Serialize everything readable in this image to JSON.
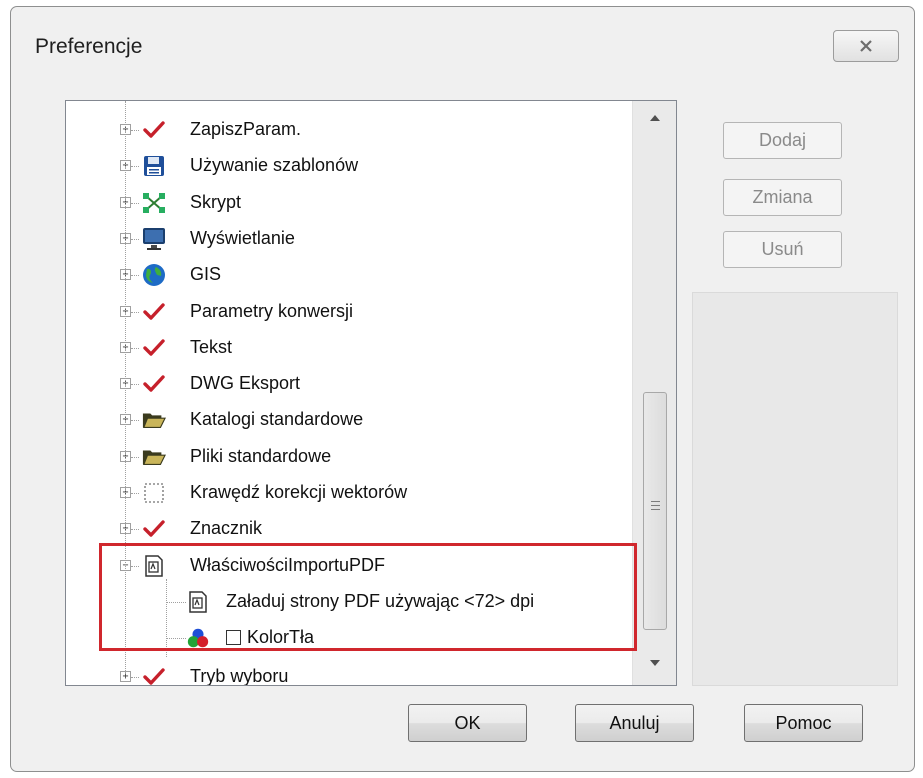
{
  "window": {
    "title": "Preferencje"
  },
  "tree": {
    "items": [
      {
        "label": "ZapiszParam.",
        "icon": "check-mark-icon"
      },
      {
        "label": "Używanie szablonów",
        "icon": "floppy-disk-icon"
      },
      {
        "label": "Skrypt",
        "icon": "script-network-icon"
      },
      {
        "label": "Wyświetlanie",
        "icon": "monitor-icon"
      },
      {
        "label": "GIS",
        "icon": "globe-icon"
      },
      {
        "label": "Parametry konwersji",
        "icon": "check-mark-icon"
      },
      {
        "label": "Tekst",
        "icon": "check-mark-icon"
      },
      {
        "label": "DWG Eksport",
        "icon": "check-mark-icon"
      },
      {
        "label": "Katalogi standardowe",
        "icon": "open-folder-icon"
      },
      {
        "label": "Pliki standardowe",
        "icon": "open-folder-icon"
      },
      {
        "label": "Krawędź korekcji wektorów",
        "icon": "dotted-frame-icon"
      },
      {
        "label": "Znacznik",
        "icon": "check-mark-icon"
      },
      {
        "label": "WłaściwościImportuPDF",
        "icon": "pdf-page-icon",
        "expanded": true
      },
      {
        "label": "Załaduj strony PDF używając <72> dpi",
        "icon": "pdf-page-icon",
        "child": true
      },
      {
        "label": "KolorTła",
        "icon": "color-circles-icon",
        "child": true,
        "checkbox": true
      },
      {
        "label": "Tryb wyboru",
        "icon": "check-mark-icon"
      }
    ]
  },
  "side_buttons": {
    "add": "Dodaj",
    "change": "Zmiana",
    "delete": "Usuń"
  },
  "footer": {
    "ok": "OK",
    "cancel": "Anuluj",
    "help": "Pomoc"
  },
  "colors": {
    "highlight": "#d0272d",
    "check": "#c6202b"
  }
}
